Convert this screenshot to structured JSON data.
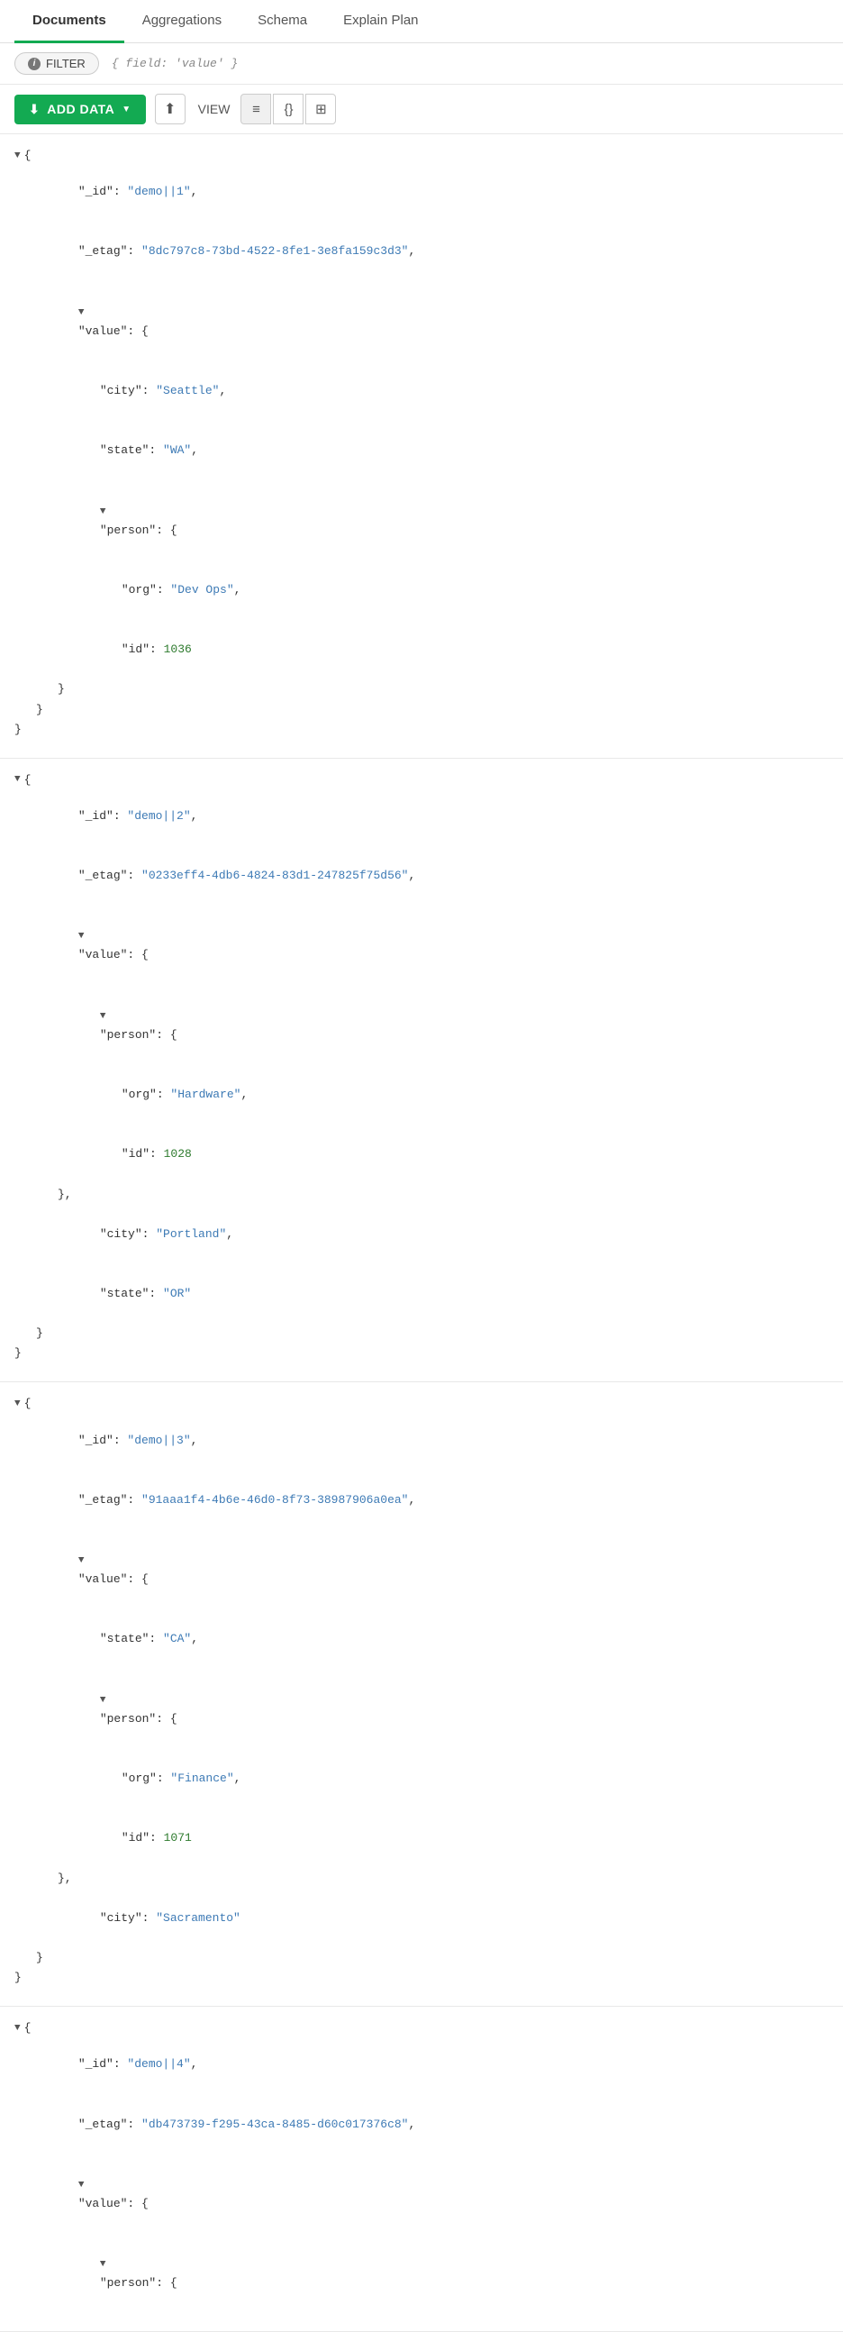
{
  "tabs": [
    {
      "id": "documents",
      "label": "Documents",
      "active": true
    },
    {
      "id": "aggregations",
      "label": "Aggregations",
      "active": false
    },
    {
      "id": "schema",
      "label": "Schema",
      "active": false
    },
    {
      "id": "explain-plan",
      "label": "Explain Plan",
      "active": false
    }
  ],
  "filter": {
    "button_label": "FILTER",
    "query_placeholder": "{ field: 'value' }"
  },
  "toolbar": {
    "add_data_label": "ADD DATA",
    "view_label": "VIEW",
    "upload_title": "Import",
    "view_options": [
      "list",
      "json",
      "table"
    ]
  },
  "documents": [
    {
      "id": "demo||1",
      "etag": "8dc797c8-73bd-4522-8fe1-3e8fa159c3d3",
      "value": {
        "city": "Seattle",
        "state": "WA",
        "person": {
          "org": "Dev Ops",
          "id": 1036
        }
      }
    },
    {
      "id": "demo||2",
      "etag": "0233eff4-4db6-4824-83d1-247825f75d56",
      "value": {
        "person": {
          "org": "Hardware",
          "id": 1028
        },
        "city": "Portland",
        "state": "OR"
      }
    },
    {
      "id": "demo||3",
      "etag": "91aaa1f4-4b6e-46d0-8f73-38987906a0ea",
      "value": {
        "state": "CA",
        "person": {
          "org": "Finance",
          "id": 1071
        },
        "city": "Sacramento"
      }
    },
    {
      "id": "demo||4",
      "etag": "db473739-f295-43ca-8485-d60c017376c8",
      "value": {
        "person": {}
      }
    }
  ],
  "colors": {
    "active_tab_underline": "#13aa52",
    "add_data_btn": "#13aa52",
    "json_string": "#3d7ab5",
    "json_number": "#2d7a2d"
  }
}
